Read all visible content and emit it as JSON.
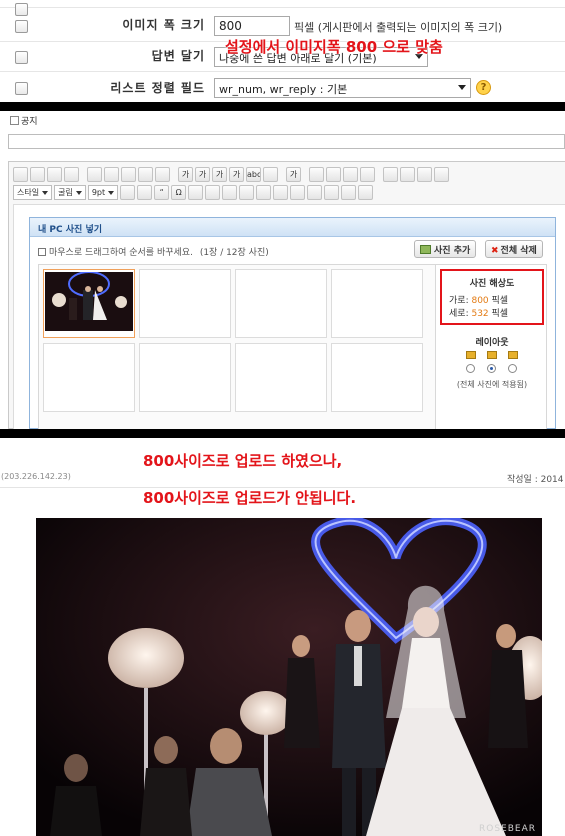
{
  "settings": {
    "rows": [
      {
        "label": "이미지 폭 크기",
        "value": "800",
        "suffix": "픽셀 (게시판에서 출력되는 이미지의 폭 크기)"
      },
      {
        "label": "답변 달기",
        "value": "나중에 쓴 답변 아래로 달기 (기본)"
      },
      {
        "label": "리스트 정렬 필드",
        "value": "wr_num, wr_reply : 기본"
      }
    ],
    "annotation": "설정에서 이미지폭 800 으로 맞춤",
    "help_icon": "question-icon"
  },
  "editor": {
    "notice_label": "공지",
    "toolbar": {
      "row1": [
        "new-doc",
        "open",
        "undo",
        "redo",
        "copy",
        "cut",
        "paste",
        "paste-text",
        "select-all",
        "가",
        "가",
        "가",
        "가",
        "ABC",
        "highlight",
        "가",
        "align-left",
        "align-center",
        "align-right",
        "align-justify",
        "ordered-list",
        "unordered-list",
        "outdent",
        "indent"
      ],
      "row2_combos": [
        "스타일",
        "굴림",
        "9pt"
      ],
      "row2": [
        "spell",
        "clean",
        "quote",
        "omega",
        "strike",
        "emoticon",
        "table",
        "hr",
        "image",
        "link",
        "box",
        "flash",
        "media",
        "preview",
        "source"
      ]
    },
    "photo_dialog": {
      "title": "내 PC 사진 넣기",
      "hint": "마우스로 드래그하여 순서를 바꾸세요.",
      "count": "(1장 / 12장 사진)",
      "add_label": "사진 추가",
      "delete_all_label": "전체 삭제",
      "resolution_title": "사진 해상도",
      "width_label": "가로",
      "width_value": "800",
      "height_label": "세로",
      "height_value": "532",
      "unit": "픽셀",
      "layout_title": "레이아웃",
      "apply_note": "(전체 사진에 적용됨)"
    }
  },
  "post": {
    "note_line1": "800사이즈로 업로드 하였으나,",
    "note_line2": "800사이즈로 업로드가 안됩니다.",
    "ip": "(203.226.142.23)",
    "date_label": "작성일 : 2014",
    "watermark": "ROSEBEAR"
  },
  "colors": {
    "annotation_red": "#e3141a",
    "value_orange": "#e37a12",
    "dialog_blue": "#1f4f8a"
  }
}
